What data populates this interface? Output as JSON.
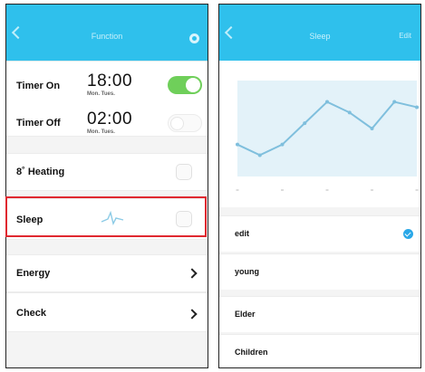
{
  "left": {
    "header": {
      "title": "Function"
    },
    "timer_on": {
      "label": "Timer On",
      "time": "18:00",
      "days": "Mon. Tues.",
      "enabled": true
    },
    "timer_off": {
      "label": "Timer Off",
      "time": "02:00",
      "days": "Mon. Tues.",
      "enabled": false
    },
    "heating": {
      "label": "8˚ Heating",
      "checked": false
    },
    "sleep": {
      "label": "Sleep",
      "checked": false
    },
    "energy": {
      "label": "Energy"
    },
    "check": {
      "label": "Check"
    }
  },
  "right": {
    "header": {
      "title": "Sleep",
      "action": "Edit"
    },
    "modes": [
      {
        "label": "edit",
        "selected": true
      },
      {
        "label": "young",
        "selected": false
      },
      {
        "label": "Elder",
        "selected": false
      },
      {
        "label": "Children",
        "selected": false
      }
    ]
  },
  "chart_data": {
    "type": "line",
    "x": [
      1,
      2,
      3,
      4,
      5,
      6,
      7,
      8,
      9
    ],
    "values": [
      26,
      24,
      26,
      30,
      34,
      32,
      29,
      34,
      33
    ],
    "ylim": [
      20,
      38
    ],
    "grid": false
  },
  "colors": {
    "header": "#2fc0ec",
    "toggle_on": "#6fcf5a",
    "highlight": "#e0282f",
    "chart_fill": "#e3f2f9",
    "chart_line": "#7fbfdd",
    "selected_badge": "#2aa8e8"
  }
}
